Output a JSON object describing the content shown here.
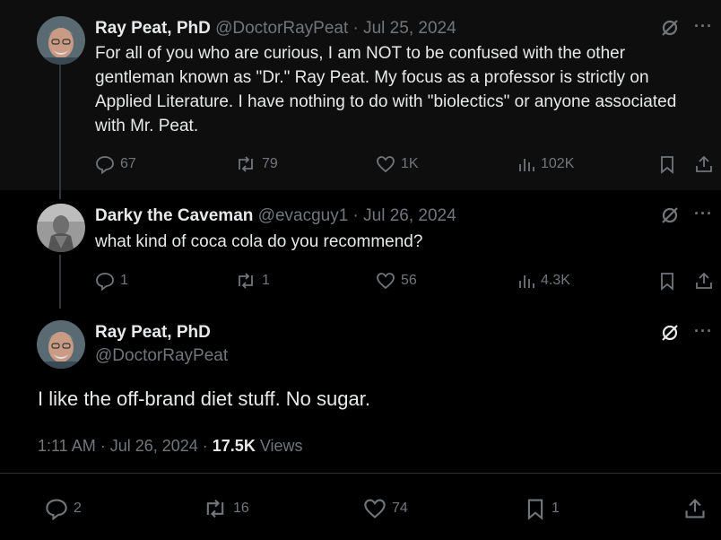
{
  "tweet1": {
    "name": "Ray Peat, PhD",
    "meta": "@DoctorRayPeat · Jul 25, 2024",
    "text": "For all of you who are curious, I am NOT to be confused with the other gentleman known as \"Dr.\" Ray Peat. My focus as a professor is strictly on Applied Literature. I have nothing to do with \"biolectics\" or anyone associated with Mr. Peat.",
    "replies": "67",
    "reposts": "79",
    "likes": "1K",
    "views": "102K"
  },
  "tweet2": {
    "name": "Darky the Caveman",
    "meta": "@evacguy1 · Jul 26, 2024",
    "text": "what kind of coca cola do you recommend?",
    "replies": "1",
    "reposts": "1",
    "likes": "56",
    "views": "4.3K"
  },
  "tweet3": {
    "name": "Ray Peat, PhD",
    "handle": "@DoctorRayPeat",
    "text": "I like the off-brand diet stuff. No sugar.",
    "time": "1:11 AM · Jul 26, 2024 · ",
    "view_count": "17.5K",
    "views_label": " Views",
    "replies": "2",
    "reposts": "16",
    "likes": "74",
    "bookmarks": "1"
  },
  "icons": [
    "reply-icon",
    "repost-icon",
    "like-icon",
    "views-icon",
    "bookmark-icon",
    "share-icon",
    "grok-icon",
    "more-icon"
  ],
  "colors": {
    "background": "#000000",
    "text": "#e7e9ea",
    "muted": "#71767b",
    "thread_line": "#333639"
  }
}
